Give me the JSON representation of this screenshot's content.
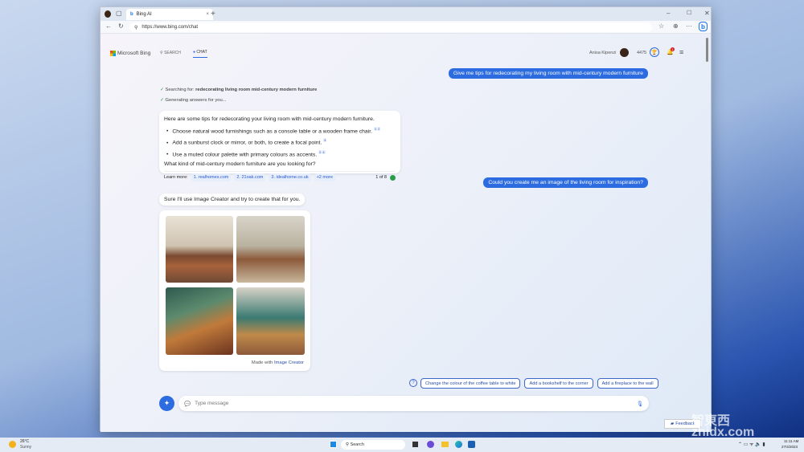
{
  "browser": {
    "tab_title": "Bing AI",
    "new_tab": "+",
    "url": "https://www.bing.com/chat",
    "window_controls": [
      "–",
      "☐",
      "✕"
    ]
  },
  "header": {
    "logo": "Microsoft Bing",
    "search_tab": "SEARCH",
    "chat_tab": "CHAT",
    "user_name": "Anisa Kipenzi",
    "points": "4475",
    "notif_count": "1"
  },
  "chat": {
    "user_messages": [
      "Give me tips for redecorating my living room with mid-century modern furniture",
      "Could you create me an image of the living room for inspiration?"
    ],
    "status": {
      "searching_prefix": "Searching for: ",
      "searching_query": "redecorating living room mid-century modern furniture",
      "generating": "Generating answers for you..."
    },
    "answer": {
      "intro": "Here are some tips for redecorating your living room with mid-century modern furniture.",
      "tips": [
        {
          "text": "Choose natural wood furnishings such as a console table or a wooden frame chair.",
          "refs": [
            "1",
            "2"
          ]
        },
        {
          "text": "Add a sunburst clock or mirror, or both, to create a focal point.",
          "refs": [
            "3"
          ]
        },
        {
          "text": "Use a muted colour palette with primary colours as accents.",
          "refs": [
            "2",
            "4"
          ]
        }
      ],
      "question": "What kind of mid-century modern furniture are you looking for?",
      "learn_more_label": "Learn more:",
      "sources": [
        "1. realhomes.com",
        "2. 21oak.com",
        "3. idealhome.co.uk",
        "+2 more"
      ],
      "counter": "1 of 8",
      "counter_color": "#2a9d4a"
    },
    "reply2": "Sure I'll use Image Creator and try to create that for you.",
    "images_credit_prefix": "Made with ",
    "images_credit_link": "Image Creator",
    "suggestions": [
      "Change the colour of the coffee table to white",
      "Add a bookshelf to the corner",
      "Add a fireplace to the wall"
    ],
    "input_placeholder": "Type message",
    "feedback": "Feedback"
  },
  "taskbar": {
    "weather_temp": "26°C",
    "weather_desc": "Sunny",
    "search": "Search",
    "time": "11:11 AM",
    "date": "27/4/2023"
  },
  "watermark": "智東西 zhidx.com",
  "colors": {
    "accent": "#2c6be0"
  }
}
